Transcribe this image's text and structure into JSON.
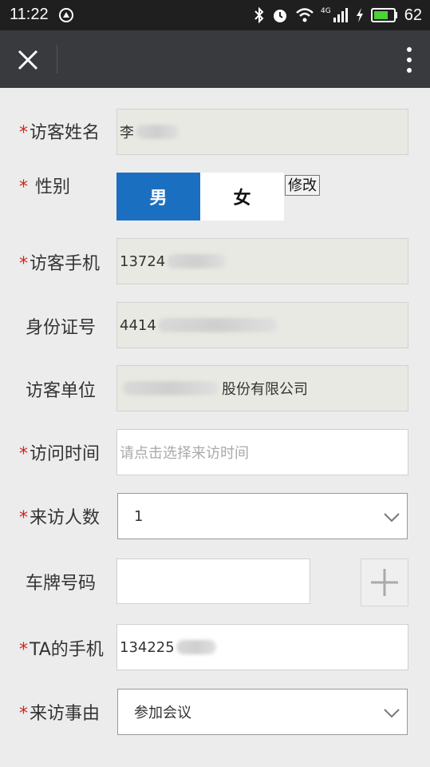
{
  "status_bar": {
    "time": "11:22",
    "battery_percent": "62",
    "network_label": "4G",
    "icons": [
      "app-notification-icon",
      "bluetooth-icon",
      "alarm-icon",
      "wifi-icon",
      "signal-icon",
      "charging-icon",
      "battery-icon"
    ]
  },
  "nav": {
    "icons": [
      "close-icon",
      "more-vertical-icon"
    ]
  },
  "form": {
    "name": {
      "required_mark": "*",
      "label": "访客姓名",
      "value": "李"
    },
    "gender": {
      "required_mark": "*",
      "label": "性别",
      "male": "男",
      "female": "女",
      "selected": "男",
      "edit_label": "修改"
    },
    "phone": {
      "required_mark": "*",
      "label": "访客手机",
      "value": "13724"
    },
    "id_number": {
      "label": "身份证号",
      "value": "4414"
    },
    "company": {
      "label": "访客单位",
      "value": "股份有限公司"
    },
    "visit_time": {
      "required_mark": "*",
      "label": "访问时间",
      "placeholder": "请点击选择来访时间"
    },
    "visitor_count": {
      "required_mark": "*",
      "label": "来访人数",
      "value": "1"
    },
    "plate": {
      "label": "车牌号码",
      "value": ""
    },
    "host_phone": {
      "required_mark": "*",
      "label": "TA的手机",
      "value": "134225"
    },
    "reason": {
      "required_mark": "*",
      "label": "来访事由",
      "value": "参加会议"
    }
  },
  "colors": {
    "accent_blue": "#1b6fc0",
    "required_red": "#d2231a",
    "nav_bg": "#393a3e",
    "status_bg": "#1f1f1f"
  }
}
